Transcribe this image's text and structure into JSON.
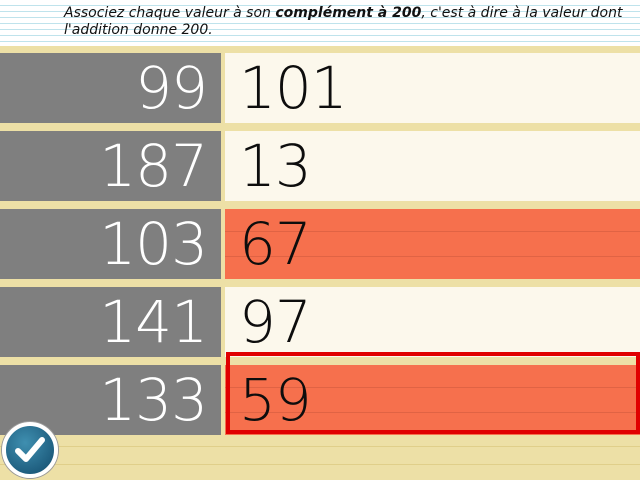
{
  "instruction": {
    "before": "Associez chaque valeur à son ",
    "bold": "complément à 200",
    "after": ", c'est à dire à la valeur dont l'addition donne 200."
  },
  "rows": [
    {
      "left": "99",
      "right": "101",
      "state": "normal"
    },
    {
      "left": "187",
      "right": "13",
      "state": "normal"
    },
    {
      "left": "103",
      "right": "67",
      "state": "wrong"
    },
    {
      "left": "141",
      "right": "97",
      "state": "normal"
    },
    {
      "left": "133",
      "right": "59",
      "state": "wrong"
    }
  ],
  "colors": {
    "left_cell": "#7f7f7f",
    "right_cell": "#fcf8ec",
    "wrong_cell": "#f6704d",
    "selection": "#e00000",
    "background": "#ede0a6"
  },
  "selected_row": 4,
  "validate_button": {
    "icon": "checkmark-icon"
  }
}
